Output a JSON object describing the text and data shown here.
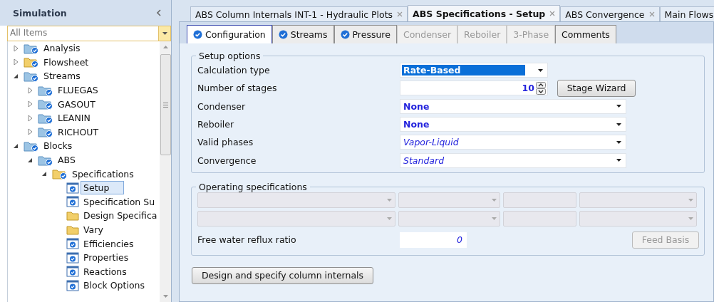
{
  "sidebar": {
    "title": "Simulation",
    "filter": {
      "value": "All Items"
    },
    "tree": [
      {
        "label": "Analysis",
        "kind": "blue-folder",
        "expanded": false,
        "selected": false
      },
      {
        "label": "Flowsheet",
        "kind": "yellow-folder",
        "expanded": false,
        "selected": false
      },
      {
        "label": "Streams",
        "kind": "blue-folder",
        "expanded": true,
        "selected": false,
        "children": [
          {
            "label": "FLUEGAS",
            "kind": "blue-folder",
            "expanded": false,
            "selected": false
          },
          {
            "label": "GASOUT",
            "kind": "blue-folder",
            "expanded": false,
            "selected": false
          },
          {
            "label": "LEANIN",
            "kind": "blue-folder",
            "expanded": false,
            "selected": false
          },
          {
            "label": "RICHOUT",
            "kind": "blue-folder",
            "expanded": false,
            "selected": false
          }
        ]
      },
      {
        "label": "Blocks",
        "kind": "blue-folder",
        "expanded": true,
        "selected": false,
        "children": [
          {
            "label": "ABS",
            "kind": "blue-folder",
            "expanded": true,
            "selected": false,
            "children": [
              {
                "label": "Specifications",
                "kind": "yellow-folder",
                "expanded": true,
                "selected": false,
                "children": [
                  {
                    "label": "Setup",
                    "kind": "form",
                    "selected": true
                  },
                  {
                    "label": "Specification Su",
                    "kind": "form",
                    "selected": false
                  },
                  {
                    "label": "Design Specifica",
                    "kind": "plain-folder",
                    "selected": false
                  },
                  {
                    "label": "Vary",
                    "kind": "plain-folder",
                    "selected": false
                  },
                  {
                    "label": "Efficiencies",
                    "kind": "form",
                    "selected": false
                  },
                  {
                    "label": "Properties",
                    "kind": "form",
                    "selected": false
                  },
                  {
                    "label": "Reactions",
                    "kind": "form",
                    "selected": false
                  },
                  {
                    "label": "Block Options",
                    "kind": "form",
                    "selected": false
                  }
                ]
              }
            ]
          }
        ]
      }
    ]
  },
  "document_tabs": [
    {
      "label": "ABS Column Internals INT-1 - Hydraulic Plots",
      "selected": false
    },
    {
      "label": "ABS Specifications - Setup",
      "selected": true
    },
    {
      "label": "ABS Convergence",
      "selected": false
    },
    {
      "label": "Main Flows",
      "selected": false
    }
  ],
  "form_tabs": [
    {
      "label": "Configuration",
      "selected": true,
      "checked": true,
      "disabled": false
    },
    {
      "label": "Streams",
      "selected": false,
      "checked": true,
      "disabled": false
    },
    {
      "label": "Pressure",
      "selected": false,
      "checked": true,
      "disabled": false
    },
    {
      "label": "Condenser",
      "selected": false,
      "checked": false,
      "disabled": true
    },
    {
      "label": "Reboiler",
      "selected": false,
      "checked": false,
      "disabled": true
    },
    {
      "label": "3-Phase",
      "selected": false,
      "checked": false,
      "disabled": true
    },
    {
      "label": "Comments",
      "selected": false,
      "checked": false,
      "disabled": false
    }
  ],
  "setup_options": {
    "title": "Setup options",
    "rows": [
      {
        "label": "Calculation type",
        "kind": "dropdown",
        "value": "Rate-Based",
        "default": false,
        "highlighted": true
      },
      {
        "label": "Number of stages",
        "kind": "spinner",
        "value": "10",
        "default": false,
        "button": "Stage Wizard"
      },
      {
        "label": "Condenser",
        "kind": "dropdown",
        "value": "None",
        "default": false,
        "highlighted": false
      },
      {
        "label": "Reboiler",
        "kind": "dropdown",
        "value": "None",
        "default": false,
        "highlighted": false
      },
      {
        "label": "Valid phases",
        "kind": "dropdown",
        "value": "Vapor-Liquid",
        "default": true,
        "highlighted": false
      },
      {
        "label": "Convergence",
        "kind": "dropdown",
        "value": "Standard",
        "default": true,
        "highlighted": false
      }
    ]
  },
  "operating_specifications": {
    "title": "Operating specifications",
    "rows": [
      {
        "fields": [
          {
            "kind": "dropdown",
            "disabled": true
          },
          {
            "kind": "dropdown",
            "disabled": true
          },
          {
            "kind": "text",
            "disabled": true
          },
          {
            "kind": "dropdown",
            "disabled": true
          }
        ]
      },
      {
        "fields": [
          {
            "kind": "dropdown",
            "disabled": true
          },
          {
            "kind": "dropdown",
            "disabled": true
          },
          {
            "kind": "text",
            "disabled": true
          },
          {
            "kind": "dropdown",
            "disabled": true
          }
        ]
      }
    ],
    "reflux": {
      "label": "Free water reflux ratio",
      "value": "0"
    },
    "feed_basis_button": {
      "label": "Feed Basis",
      "disabled": true
    }
  },
  "internals_button": "Design and specify column internals"
}
